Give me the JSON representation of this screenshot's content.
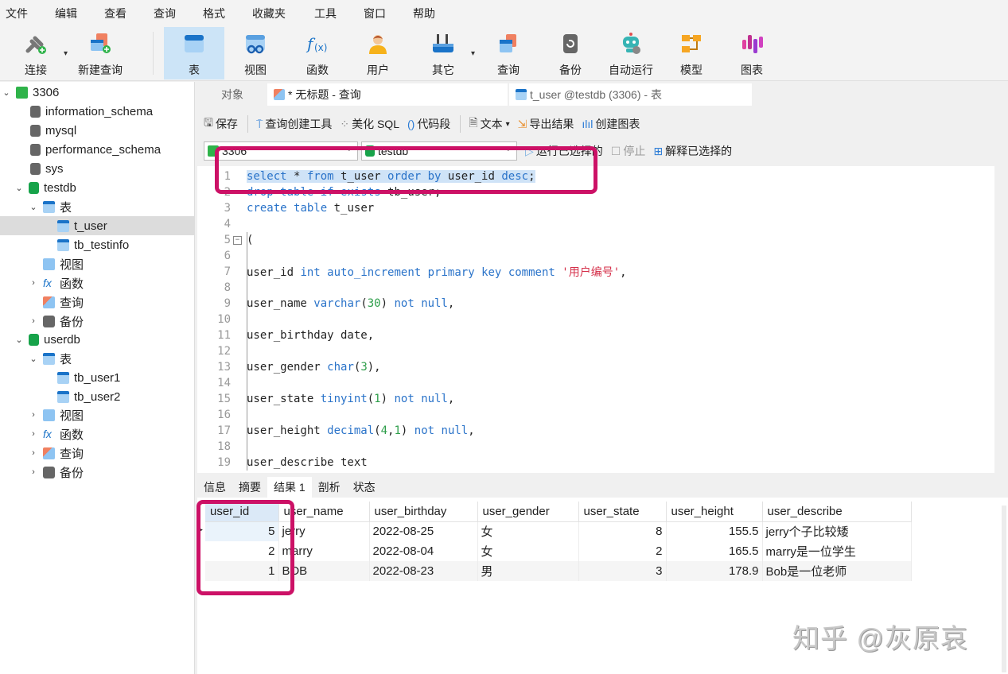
{
  "menu": [
    "文件",
    "编辑",
    "查看",
    "查询",
    "格式",
    "收藏夹",
    "工具",
    "窗口",
    "帮助"
  ],
  "toolbar": {
    "connect": "连接",
    "new_query": "新建查询",
    "table": "表",
    "view": "视图",
    "function": "函数",
    "user": "用户",
    "other": "其它",
    "query": "查询",
    "backup": "备份",
    "automation": "自动运行",
    "model": "模型",
    "chart": "图表"
  },
  "sidebar": {
    "connection": "3306",
    "items": [
      {
        "label": "information_schema",
        "type": "db-gray"
      },
      {
        "label": "mysql",
        "type": "db-gray"
      },
      {
        "label": "performance_schema",
        "type": "db-gray"
      },
      {
        "label": "sys",
        "type": "db-gray"
      },
      {
        "label": "testdb",
        "type": "db-green"
      },
      {
        "label": "表"
      },
      {
        "label": "t_user"
      },
      {
        "label": "tb_testinfo"
      },
      {
        "label": "视图"
      },
      {
        "label": "函数"
      },
      {
        "label": "查询"
      },
      {
        "label": "备份"
      },
      {
        "label": "userdb",
        "type": "db-green"
      },
      {
        "label": "表"
      },
      {
        "label": "tb_user1"
      },
      {
        "label": "tb_user2"
      },
      {
        "label": "视图"
      },
      {
        "label": "函数"
      },
      {
        "label": "查询"
      },
      {
        "label": "备份"
      }
    ]
  },
  "tabs": {
    "objects": "对象",
    "query": "* 无标题 - 查询",
    "table": "t_user @testdb (3306) - 表"
  },
  "querybar": {
    "save": "保存",
    "query_builder": "查询创建工具",
    "beautify": "美化 SQL",
    "snippet": "代码段",
    "text": "文本",
    "export": "导出结果",
    "create_chart": "创建图表"
  },
  "connbar": {
    "connection": "3306",
    "database": "testdb",
    "run_selected": "运行已选择的",
    "stop": "停止",
    "explain_selected": "解释已选择的"
  },
  "editor": {
    "lines": [
      "select * from t_user order by user_id desc;",
      "drop table if exists tb_user;",
      "create table t_user",
      "",
      "(",
      "",
      "user_id int auto_increment primary key comment '用户编号',",
      "",
      "user_name varchar(30) not null,",
      "",
      "user_birthday date,",
      "",
      "user_gender char(3),",
      "",
      "user_state tinyint(1) not null,",
      "",
      "user_height decimal(4,1) not null,",
      "",
      "user_describe text"
    ]
  },
  "result_tabs": [
    "信息",
    "摘要",
    "结果 1",
    "剖析",
    "状态"
  ],
  "result": {
    "columns": [
      "user_id",
      "user_name",
      "user_birthday",
      "user_gender",
      "user_state",
      "user_height",
      "user_describe"
    ],
    "rows": [
      [
        "5",
        "jerry",
        "2022-08-25",
        "女",
        "8",
        "155.5",
        "jerry个子比较矮"
      ],
      [
        "2",
        "marry",
        "2022-08-04",
        "女",
        "2",
        "165.5",
        "marry是一位学生"
      ],
      [
        "1",
        "BOB",
        "2022-08-23",
        "男",
        "3",
        "178.9",
        "Bob是一位老师"
      ]
    ]
  },
  "watermark": "知乎 @灰原哀",
  "colors": {
    "annotation": "#cc1166",
    "keyword": "#2a73c9",
    "selection": "#cfe3f7",
    "active_tool": "#cce4f7"
  }
}
